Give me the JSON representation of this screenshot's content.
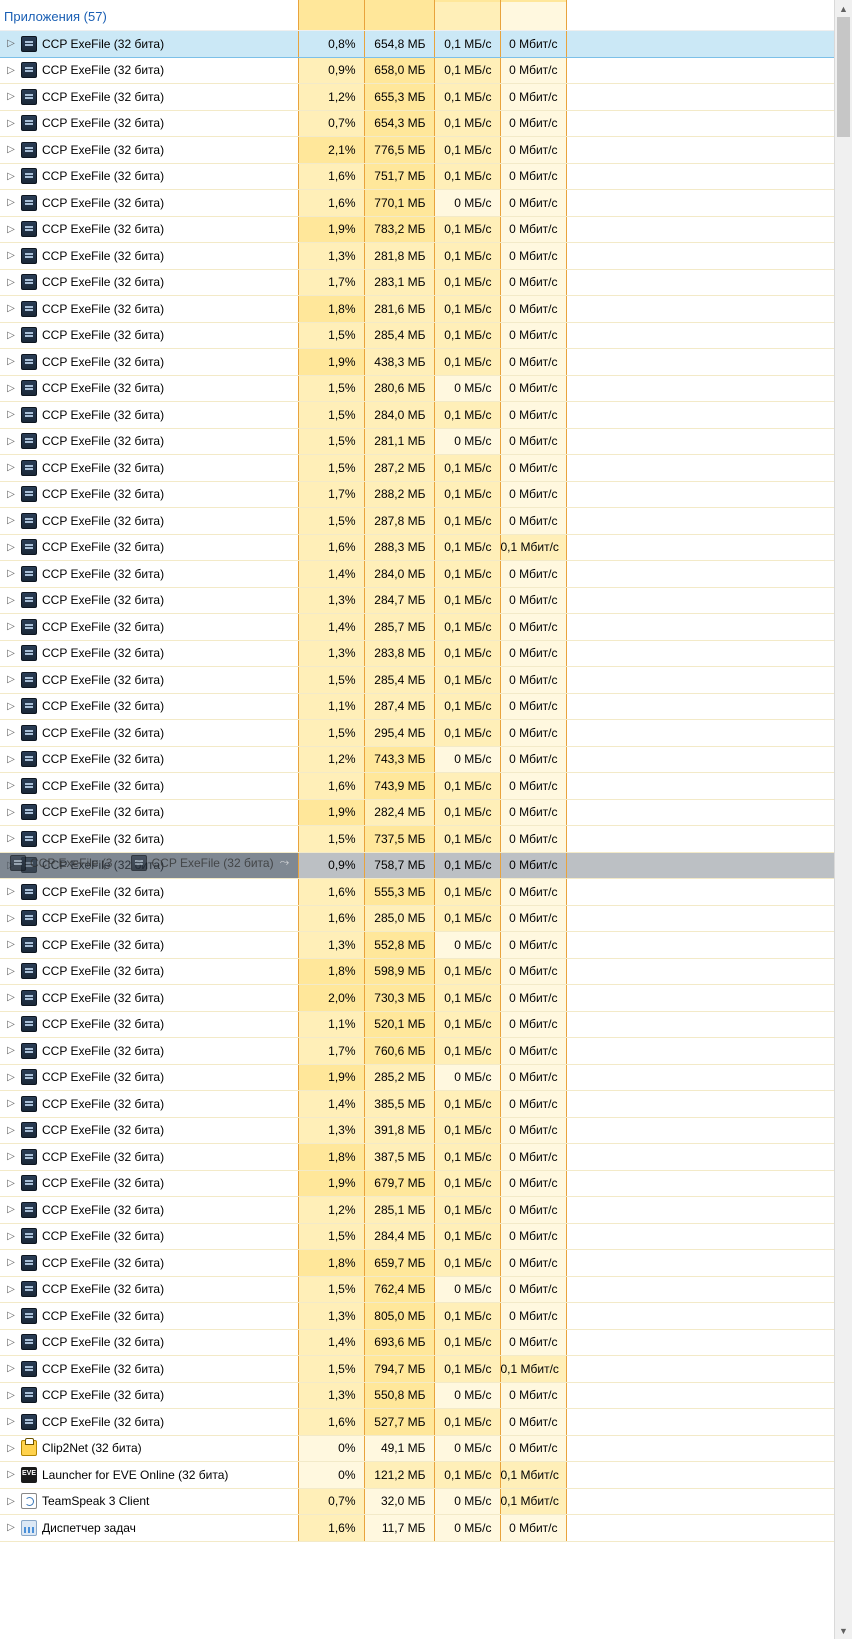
{
  "group": {
    "label": "Приложения (57)"
  },
  "icons": {
    "ccp": "i-ccp",
    "clip": "i-clip",
    "eve": "i-eve",
    "ts": "i-ts",
    "task": "i-task"
  },
  "rows": [
    {
      "icon": "ccp",
      "name": "CCP ExeFile (32 бита)",
      "cpu": "0,8%",
      "mem": "654,8 МБ",
      "disk": "0,1 МБ/с",
      "net": "0 Мбит/с",
      "selected": true
    },
    {
      "icon": "ccp",
      "name": "CCP ExeFile (32 бита)",
      "cpu": "0,9%",
      "mem": "658,0 МБ",
      "disk": "0,1 МБ/с",
      "net": "0 Мбит/с"
    },
    {
      "icon": "ccp",
      "name": "CCP ExeFile (32 бита)",
      "cpu": "1,2%",
      "mem": "655,3 МБ",
      "disk": "0,1 МБ/с",
      "net": "0 Мбит/с"
    },
    {
      "icon": "ccp",
      "name": "CCP ExeFile (32 бита)",
      "cpu": "0,7%",
      "mem": "654,3 МБ",
      "disk": "0,1 МБ/с",
      "net": "0 Мбит/с"
    },
    {
      "icon": "ccp",
      "name": "CCP ExeFile (32 бита)",
      "cpu": "2,1%",
      "mem": "776,5 МБ",
      "disk": "0,1 МБ/с",
      "net": "0 Мбит/с"
    },
    {
      "icon": "ccp",
      "name": "CCP ExeFile (32 бита)",
      "cpu": "1,6%",
      "mem": "751,7 МБ",
      "disk": "0,1 МБ/с",
      "net": "0 Мбит/с"
    },
    {
      "icon": "ccp",
      "name": "CCP ExeFile (32 бита)",
      "cpu": "1,6%",
      "mem": "770,1 МБ",
      "disk": "0 МБ/с",
      "net": "0 Мбит/с"
    },
    {
      "icon": "ccp",
      "name": "CCP ExeFile (32 бита)",
      "cpu": "1,9%",
      "mem": "783,2 МБ",
      "disk": "0,1 МБ/с",
      "net": "0 Мбит/с"
    },
    {
      "icon": "ccp",
      "name": "CCP ExeFile (32 бита)",
      "cpu": "1,3%",
      "mem": "281,8 МБ",
      "disk": "0,1 МБ/с",
      "net": "0 Мбит/с"
    },
    {
      "icon": "ccp",
      "name": "CCP ExeFile (32 бита)",
      "cpu": "1,7%",
      "mem": "283,1 МБ",
      "disk": "0,1 МБ/с",
      "net": "0 Мбит/с"
    },
    {
      "icon": "ccp",
      "name": "CCP ExeFile (32 бита)",
      "cpu": "1,8%",
      "mem": "281,6 МБ",
      "disk": "0,1 МБ/с",
      "net": "0 Мбит/с"
    },
    {
      "icon": "ccp",
      "name": "CCP ExeFile (32 бита)",
      "cpu": "1,5%",
      "mem": "285,4 МБ",
      "disk": "0,1 МБ/с",
      "net": "0 Мбит/с"
    },
    {
      "icon": "ccp",
      "name": "CCP ExeFile (32 бита)",
      "cpu": "1,9%",
      "mem": "438,3 МБ",
      "disk": "0,1 МБ/с",
      "net": "0 Мбит/с"
    },
    {
      "icon": "ccp",
      "name": "CCP ExeFile (32 бита)",
      "cpu": "1,5%",
      "mem": "280,6 МБ",
      "disk": "0 МБ/с",
      "net": "0 Мбит/с"
    },
    {
      "icon": "ccp",
      "name": "CCP ExeFile (32 бита)",
      "cpu": "1,5%",
      "mem": "284,0 МБ",
      "disk": "0,1 МБ/с",
      "net": "0 Мбит/с"
    },
    {
      "icon": "ccp",
      "name": "CCP ExeFile (32 бита)",
      "cpu": "1,5%",
      "mem": "281,1 МБ",
      "disk": "0 МБ/с",
      "net": "0 Мбит/с"
    },
    {
      "icon": "ccp",
      "name": "CCP ExeFile (32 бита)",
      "cpu": "1,5%",
      "mem": "287,2 МБ",
      "disk": "0,1 МБ/с",
      "net": "0 Мбит/с"
    },
    {
      "icon": "ccp",
      "name": "CCP ExeFile (32 бита)",
      "cpu": "1,7%",
      "mem": "288,2 МБ",
      "disk": "0,1 МБ/с",
      "net": "0 Мбит/с"
    },
    {
      "icon": "ccp",
      "name": "CCP ExeFile (32 бита)",
      "cpu": "1,5%",
      "mem": "287,8 МБ",
      "disk": "0,1 МБ/с",
      "net": "0 Мбит/с"
    },
    {
      "icon": "ccp",
      "name": "CCP ExeFile (32 бита)",
      "cpu": "1,6%",
      "mem": "288,3 МБ",
      "disk": "0,1 МБ/с",
      "net": "0,1 Мбит/с"
    },
    {
      "icon": "ccp",
      "name": "CCP ExeFile (32 бита)",
      "cpu": "1,4%",
      "mem": "284,0 МБ",
      "disk": "0,1 МБ/с",
      "net": "0 Мбит/с"
    },
    {
      "icon": "ccp",
      "name": "CCP ExeFile (32 бита)",
      "cpu": "1,3%",
      "mem": "284,7 МБ",
      "disk": "0,1 МБ/с",
      "net": "0 Мбит/с"
    },
    {
      "icon": "ccp",
      "name": "CCP ExeFile (32 бита)",
      "cpu": "1,4%",
      "mem": "285,7 МБ",
      "disk": "0,1 МБ/с",
      "net": "0 Мбит/с"
    },
    {
      "icon": "ccp",
      "name": "CCP ExeFile (32 бита)",
      "cpu": "1,3%",
      "mem": "283,8 МБ",
      "disk": "0,1 МБ/с",
      "net": "0 Мбит/с"
    },
    {
      "icon": "ccp",
      "name": "CCP ExeFile (32 бита)",
      "cpu": "1,5%",
      "mem": "285,4 МБ",
      "disk": "0,1 МБ/с",
      "net": "0 Мбит/с"
    },
    {
      "icon": "ccp",
      "name": "CCP ExeFile (32 бита)",
      "cpu": "1,1%",
      "mem": "287,4 МБ",
      "disk": "0,1 МБ/с",
      "net": "0 Мбит/с"
    },
    {
      "icon": "ccp",
      "name": "CCP ExeFile (32 бита)",
      "cpu": "1,5%",
      "mem": "295,4 МБ",
      "disk": "0,1 МБ/с",
      "net": "0 Мбит/с"
    },
    {
      "icon": "ccp",
      "name": "CCP ExeFile (32 бита)",
      "cpu": "1,2%",
      "mem": "743,3 МБ",
      "disk": "0 МБ/с",
      "net": "0 Мбит/с"
    },
    {
      "icon": "ccp",
      "name": "CCP ExeFile (32 бита)",
      "cpu": "1,6%",
      "mem": "743,9 МБ",
      "disk": "0,1 МБ/с",
      "net": "0 Мбит/с"
    },
    {
      "icon": "ccp",
      "name": "CCP ExeFile (32 бита)",
      "cpu": "1,9%",
      "mem": "282,4 МБ",
      "disk": "0,1 МБ/с",
      "net": "0 Мбит/с"
    },
    {
      "icon": "ccp",
      "name": "CCP ExeFile (32 бита)",
      "cpu": "1,5%",
      "mem": "737,5 МБ",
      "disk": "0,1 МБ/с",
      "net": "0 Мбит/с"
    },
    {
      "icon": "ccp",
      "name": "CCP ExeFile (32 бита)",
      "cpu": "0,9%",
      "mem": "758,7 МБ",
      "disk": "0,1 МБ/с",
      "net": "0 Мбит/с",
      "dragging": true
    },
    {
      "icon": "ccp",
      "name": "CCP ExeFile (32 бита)",
      "cpu": "1,6%",
      "mem": "555,3 МБ",
      "disk": "0,1 МБ/с",
      "net": "0 Мбит/с"
    },
    {
      "icon": "ccp",
      "name": "CCP ExeFile (32 бита)",
      "cpu": "1,6%",
      "mem": "285,0 МБ",
      "disk": "0,1 МБ/с",
      "net": "0 Мбит/с"
    },
    {
      "icon": "ccp",
      "name": "CCP ExeFile (32 бита)",
      "cpu": "1,3%",
      "mem": "552,8 МБ",
      "disk": "0 МБ/с",
      "net": "0 Мбит/с"
    },
    {
      "icon": "ccp",
      "name": "CCP ExeFile (32 бита)",
      "cpu": "1,8%",
      "mem": "598,9 МБ",
      "disk": "0,1 МБ/с",
      "net": "0 Мбит/с"
    },
    {
      "icon": "ccp",
      "name": "CCP ExeFile (32 бита)",
      "cpu": "2,0%",
      "mem": "730,3 МБ",
      "disk": "0,1 МБ/с",
      "net": "0 Мбит/с"
    },
    {
      "icon": "ccp",
      "name": "CCP ExeFile (32 бита)",
      "cpu": "1,1%",
      "mem": "520,1 МБ",
      "disk": "0,1 МБ/с",
      "net": "0 Мбит/с"
    },
    {
      "icon": "ccp",
      "name": "CCP ExeFile (32 бита)",
      "cpu": "1,7%",
      "mem": "760,6 МБ",
      "disk": "0,1 МБ/с",
      "net": "0 Мбит/с"
    },
    {
      "icon": "ccp",
      "name": "CCP ExeFile (32 бита)",
      "cpu": "1,9%",
      "mem": "285,2 МБ",
      "disk": "0 МБ/с",
      "net": "0 Мбит/с"
    },
    {
      "icon": "ccp",
      "name": "CCP ExeFile (32 бита)",
      "cpu": "1,4%",
      "mem": "385,5 МБ",
      "disk": "0,1 МБ/с",
      "net": "0 Мбит/с"
    },
    {
      "icon": "ccp",
      "name": "CCP ExeFile (32 бита)",
      "cpu": "1,3%",
      "mem": "391,8 МБ",
      "disk": "0,1 МБ/с",
      "net": "0 Мбит/с"
    },
    {
      "icon": "ccp",
      "name": "CCP ExeFile (32 бита)",
      "cpu": "1,8%",
      "mem": "387,5 МБ",
      "disk": "0,1 МБ/с",
      "net": "0 Мбит/с"
    },
    {
      "icon": "ccp",
      "name": "CCP ExeFile (32 бита)",
      "cpu": "1,9%",
      "mem": "679,7 МБ",
      "disk": "0,1 МБ/с",
      "net": "0 Мбит/с"
    },
    {
      "icon": "ccp",
      "name": "CCP ExeFile (32 бита)",
      "cpu": "1,2%",
      "mem": "285,1 МБ",
      "disk": "0,1 МБ/с",
      "net": "0 Мбит/с"
    },
    {
      "icon": "ccp",
      "name": "CCP ExeFile (32 бита)",
      "cpu": "1,5%",
      "mem": "284,4 МБ",
      "disk": "0,1 МБ/с",
      "net": "0 Мбит/с"
    },
    {
      "icon": "ccp",
      "name": "CCP ExeFile (32 бита)",
      "cpu": "1,8%",
      "mem": "659,7 МБ",
      "disk": "0,1 МБ/с",
      "net": "0 Мбит/с"
    },
    {
      "icon": "ccp",
      "name": "CCP ExeFile (32 бита)",
      "cpu": "1,5%",
      "mem": "762,4 МБ",
      "disk": "0 МБ/с",
      "net": "0 Мбит/с"
    },
    {
      "icon": "ccp",
      "name": "CCP ExeFile (32 бита)",
      "cpu": "1,3%",
      "mem": "805,0 МБ",
      "disk": "0,1 МБ/с",
      "net": "0 Мбит/с"
    },
    {
      "icon": "ccp",
      "name": "CCP ExeFile (32 бита)",
      "cpu": "1,4%",
      "mem": "693,6 МБ",
      "disk": "0,1 МБ/с",
      "net": "0 Мбит/с"
    },
    {
      "icon": "ccp",
      "name": "CCP ExeFile (32 бита)",
      "cpu": "1,5%",
      "mem": "794,7 МБ",
      "disk": "0,1 МБ/с",
      "net": "0,1 Мбит/с"
    },
    {
      "icon": "ccp",
      "name": "CCP ExeFile (32 бита)",
      "cpu": "1,3%",
      "mem": "550,8 МБ",
      "disk": "0 МБ/с",
      "net": "0 Мбит/с"
    },
    {
      "icon": "ccp",
      "name": "CCP ExeFile (32 бита)",
      "cpu": "1,6%",
      "mem": "527,7 МБ",
      "disk": "0,1 МБ/с",
      "net": "0 Мбит/с"
    },
    {
      "icon": "clip",
      "name": "Clip2Net (32 бита)",
      "cpu": "0%",
      "mem": "49,1 МБ",
      "disk": "0 МБ/с",
      "net": "0 Мбит/с"
    },
    {
      "icon": "eve",
      "name": "Launcher for EVE Online (32 бита)",
      "cpu": "0%",
      "mem": "121,2 МБ",
      "disk": "0,1 МБ/с",
      "net": "0,1 Мбит/с"
    },
    {
      "icon": "ts",
      "name": "TeamSpeak 3 Client",
      "cpu": "0,7%",
      "mem": "32,0 МБ",
      "disk": "0 МБ/с",
      "net": "0,1 Мбит/с"
    },
    {
      "icon": "task",
      "name": "Диспетчер задач",
      "cpu": "1,6%",
      "mem": "11,7 МБ",
      "disk": "0 МБ/с",
      "net": "0 Мбит/с"
    }
  ],
  "drag_ghost_text": "CCP ExeFile (32 бита)"
}
